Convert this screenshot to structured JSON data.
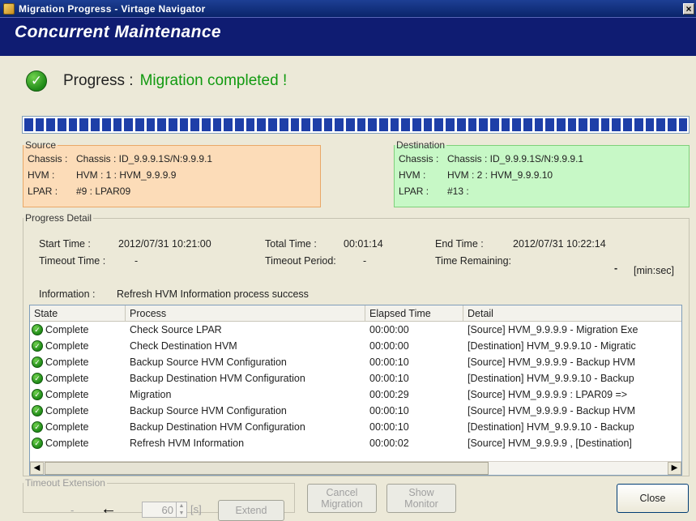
{
  "window": {
    "title": "Migration Progress - Virtage Navigator",
    "close_glyph": "×"
  },
  "banner": {
    "title": "Concurrent Maintenance"
  },
  "status": {
    "label": "Progress :",
    "value": "Migration completed !"
  },
  "progress_bar": {
    "fraction": 1.0
  },
  "source": {
    "legend": "Source",
    "chassis_key": "Chassis :",
    "chassis_val": "Chassis : ID_9.9.9.1S/N:9.9.9.1",
    "hvm_key": "HVM :",
    "hvm_val": "HVM : 1 : HVM_9.9.9.9",
    "lpar_key": "LPAR :",
    "lpar_val": "#9 : LPAR09"
  },
  "destination": {
    "legend": "Destination",
    "chassis_key": "Chassis :",
    "chassis_val": "Chassis : ID_9.9.9.1S/N:9.9.9.1",
    "hvm_key": "HVM :",
    "hvm_val": "HVM : 2 : HVM_9.9.9.10",
    "lpar_key": "LPAR :",
    "lpar_val": "#13 :"
  },
  "detail": {
    "legend": "Progress Detail",
    "start_label": "Start Time :",
    "start_value": "2012/07/31 10:21:00",
    "total_label": "Total Time :",
    "total_value": "00:01:14",
    "end_label": "End Time :",
    "end_value": "2012/07/31 10:22:14",
    "timeout_time_label": "Timeout Time :",
    "timeout_time_value": "-",
    "timeout_period_label": "Timeout Period:",
    "timeout_period_value": "-",
    "remaining_label": "Time Remaining:",
    "remaining_value": "-",
    "remaining_unit": "[min:sec]",
    "info_label": "Information :",
    "info_value": "Refresh HVM Information process success"
  },
  "table": {
    "columns": [
      "State",
      "Process",
      "Elapsed Time",
      "Detail"
    ],
    "rows": [
      {
        "state": "Complete",
        "process": "Check Source LPAR",
        "elapsed": "00:00:00",
        "detail": "[Source] HVM_9.9.9.9    - Migration Exe"
      },
      {
        "state": "Complete",
        "process": "Check Destination HVM",
        "elapsed": "00:00:00",
        "detail": "[Destination] HVM_9.9.9.10    - Migratic"
      },
      {
        "state": "Complete",
        "process": "Backup Source HVM Configuration",
        "elapsed": "00:00:10",
        "detail": "[Source] HVM_9.9.9.9    - Backup HVM"
      },
      {
        "state": "Complete",
        "process": "Backup Destination HVM Configuration",
        "elapsed": "00:00:10",
        "detail": "[Destination] HVM_9.9.9.10    - Backup"
      },
      {
        "state": "Complete",
        "process": "Migration",
        "elapsed": "00:00:29",
        "detail": "[Source] HVM_9.9.9.9    : LPAR09 =>"
      },
      {
        "state": "Complete",
        "process": "Backup Source HVM Configuration",
        "elapsed": "00:00:10",
        "detail": "[Source] HVM_9.9.9.9    - Backup HVM"
      },
      {
        "state": "Complete",
        "process": "Backup Destination HVM Configuration",
        "elapsed": "00:00:10",
        "detail": "[Destination] HVM_9.9.9.10    - Backup"
      },
      {
        "state": "Complete",
        "process": "Refresh HVM Information",
        "elapsed": "00:00:02",
        "detail": "[Source] HVM_9.9.9.9    , [Destination]"
      }
    ]
  },
  "timeout_extension": {
    "legend": "Timeout Extension",
    "dash": "-",
    "arrow": "←",
    "value": "60",
    "unit": "[s]",
    "extend_label": "Extend"
  },
  "buttons": {
    "cancel_line1": "Cancel",
    "cancel_line2": "Migration",
    "show_line1": "Show",
    "show_line2": "Monitor",
    "close": "Close"
  },
  "colors": {
    "banner": "#0f1c72",
    "progress": "#1e3fa8",
    "success": "#119a10",
    "source_bg": "#fcdcb8",
    "destination_bg": "#c7f8c6"
  }
}
